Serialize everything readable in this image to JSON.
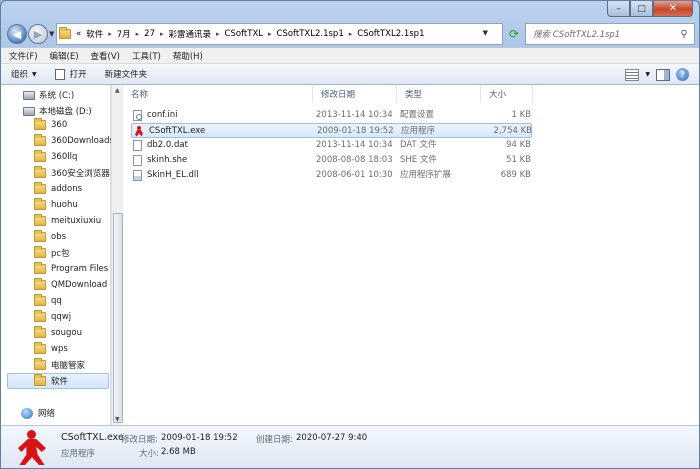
{
  "window": {
    "min": "–",
    "max": "□",
    "close": "✕"
  },
  "nav_buttons": {
    "back": "◀",
    "forward": "▶"
  },
  "address": {
    "prefix": "«",
    "crumbs": [
      "软件",
      "7月",
      "27",
      "彩雷通讯录",
      "CSoftTXL",
      "CSoftTXL2.1sp1",
      "CSoftTXL2.1sp1"
    ],
    "separator": "▸"
  },
  "search": {
    "placeholder": "搜索 CSoftTXL2.1sp1"
  },
  "menu": [
    "文件(F)",
    "编辑(E)",
    "查看(V)",
    "工具(T)",
    "帮助(H)"
  ],
  "toolbar": {
    "organize": "组织",
    "open": "打开",
    "new_folder": "新建文件夹"
  },
  "sidebar": {
    "drives": [
      {
        "label": "系统 (C:)"
      },
      {
        "label": "本地磁盘 (D:)"
      }
    ],
    "folders": [
      "360",
      "360Downloads",
      "360llq",
      "360安全浏览器",
      "addons",
      "huohu",
      "meituxiuxiu",
      "obs",
      "pc包",
      "Program Files",
      "QMDownload",
      "qq",
      "qqwj",
      "sougou",
      "wps",
      "电脑管家",
      "软件"
    ],
    "selected_folder": "软件",
    "network": "网络"
  },
  "columns": {
    "name": "名称",
    "date": "修改日期",
    "type": "类型",
    "size": "大小"
  },
  "files": [
    {
      "name": "conf.ini",
      "date": "2013-11-14 10:34",
      "type": "配置设置",
      "size": "1 KB",
      "icon": "settings-file-icon"
    },
    {
      "name": "CSoftTXL.exe",
      "date": "2009-01-18 19:52",
      "type": "应用程序",
      "size": "2,754 KB",
      "icon": "exe-icon"
    },
    {
      "name": "db2.0.dat",
      "date": "2013-11-14 10:34",
      "type": "DAT 文件",
      "size": "94 KB",
      "icon": "file-icon"
    },
    {
      "name": "skinh.she",
      "date": "2008-08-08 18:03",
      "type": "SHE 文件",
      "size": "51 KB",
      "icon": "file-icon"
    },
    {
      "name": "SkinH_EL.dll",
      "date": "2008-06-01 10:30",
      "type": "应用程序扩展",
      "size": "689 KB",
      "icon": "dll-icon"
    }
  ],
  "selected_file": "CSoftTXL.exe",
  "details": {
    "filename": "CSoftTXL.exe",
    "modified_label": "修改日期:",
    "modified_value": "2009-01-18 19:52",
    "created_label": "创建日期:",
    "created_value": "2020-07-27 9:40",
    "type": "应用程序",
    "size_label": "大小:",
    "size_value": "2.68 MB"
  }
}
